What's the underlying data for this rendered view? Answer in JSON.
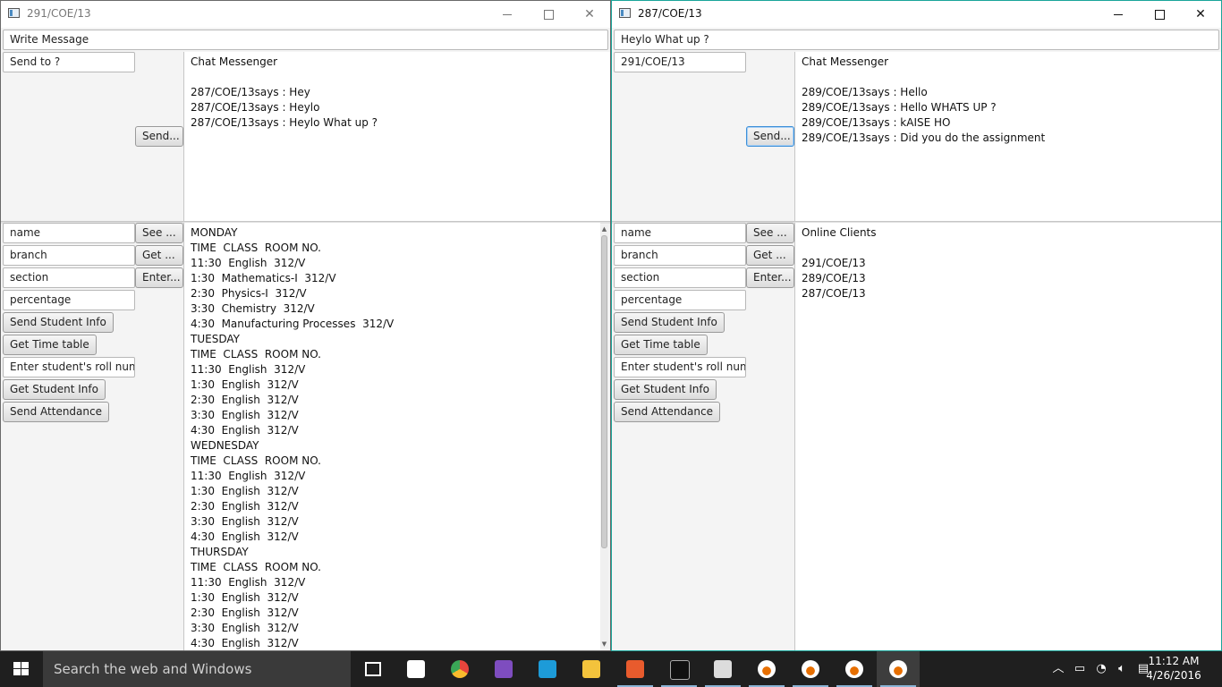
{
  "left_window": {
    "title": "291/COE/13",
    "message_field": "Write Message",
    "send_to_field": "Send to ?",
    "send_button": "Send...",
    "chat_lines": [
      "Chat Messenger",
      "",
      "287/COE/13says : Hey",
      "287/COE/13says : Heylo",
      "287/COE/13says : Heylo What up ?"
    ],
    "form": {
      "name_field": "name",
      "see_button": "See ...",
      "branch_field": "branch",
      "get_button": "Get ...",
      "section_field": "section",
      "enter_button": "Enter...",
      "percentage_field": "percentage",
      "send_student_info": "Send Student Info",
      "get_time_table": "Get Time table",
      "roll_field": "Enter student's roll numb",
      "get_student_info": "Get Student Info",
      "send_attendance": "Send Attendance"
    },
    "timetable_lines": [
      "MONDAY",
      "TIME  CLASS  ROOM NO.",
      "11:30  English  312/V",
      "1:30  Mathematics-I  312/V",
      "2:30  Physics-I  312/V",
      "3:30  Chemistry  312/V",
      "4:30  Manufacturing Processes  312/V",
      "TUESDAY",
      "TIME  CLASS  ROOM NO.",
      "11:30  English  312/V",
      "1:30  English  312/V",
      "2:30  English  312/V",
      "3:30  English  312/V",
      "4:30  English  312/V",
      "WEDNESDAY",
      "TIME  CLASS  ROOM NO.",
      "11:30  English  312/V",
      "1:30  English  312/V",
      "2:30  English  312/V",
      "3:30  English  312/V",
      "4:30  English  312/V",
      "THURSDAY",
      "TIME  CLASS  ROOM NO.",
      "11:30  English  312/V",
      "1:30  English  312/V",
      "2:30  English  312/V",
      "3:30  English  312/V",
      "4:30  English  312/V"
    ]
  },
  "right_window": {
    "title": "287/COE/13",
    "message_field": "Heylo What up ?",
    "send_to_field": "291/COE/13",
    "send_button": "Send...",
    "chat_lines": [
      "Chat Messenger",
      "",
      "289/COE/13says : Hello",
      "289/COE/13says : Hello WHATS UP ?",
      "289/COE/13says : kAISE HO",
      "289/COE/13says : Did you do the assignment"
    ],
    "form": {
      "name_field": "name",
      "see_button": "See ...",
      "branch_field": "branch",
      "get_button": "Get ...",
      "section_field": "section",
      "enter_button": "Enter...",
      "percentage_field": "percentage",
      "send_student_info": "Send Student Info",
      "get_time_table": "Get Time table",
      "roll_field": "Enter student's roll numb",
      "get_student_info": "Get Student Info",
      "send_attendance": "Send Attendance"
    },
    "online_lines": [
      "Online Clients",
      "",
      "291/COE/13",
      "289/COE/13",
      "287/COE/13"
    ]
  },
  "taskbar": {
    "search_placeholder": "Search the web and Windows",
    "time": "11:12 AM",
    "date": "4/26/2016",
    "icons": [
      "task-view-icon",
      "store-icon",
      "chrome-icon",
      "visual-studio-icon",
      "intellij-icon",
      "file-explorer-icon",
      "app-grid-icon",
      "command-prompt-icon",
      "paint-icon",
      "java-icon",
      "java-icon",
      "java-icon",
      "java-icon"
    ],
    "colors": {
      "taskbar": "#1f1f1f",
      "search": "#3a3a3a",
      "accent": "#1aa59a"
    }
  }
}
